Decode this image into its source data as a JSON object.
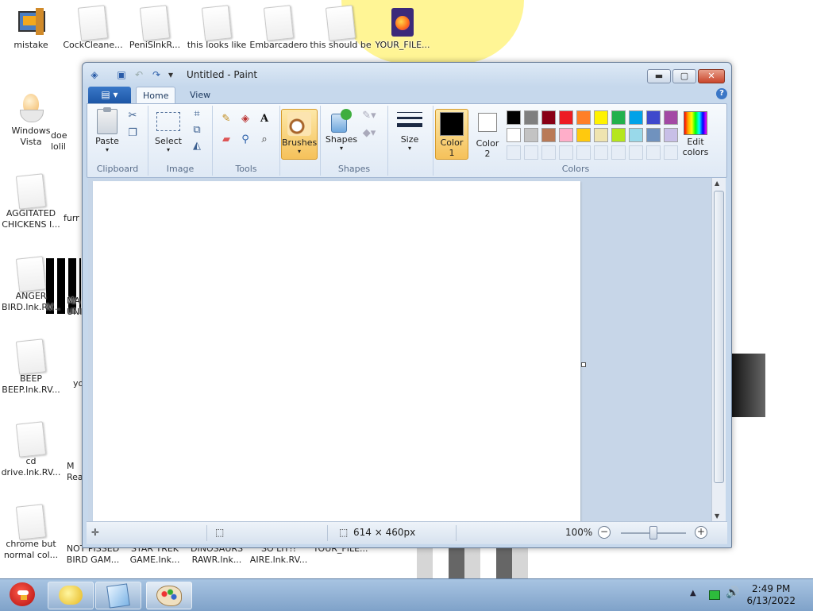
{
  "desktop": {
    "icons": [
      {
        "label": "mistake"
      },
      {
        "label": "CockCleane..."
      },
      {
        "label": "PeniSlnkR..."
      },
      {
        "label": "this looks like"
      },
      {
        "label": "Embarcadero"
      },
      {
        "label": "this should be"
      },
      {
        "label": "YOUR_FILE..."
      },
      {
        "label": "Windows\nVista"
      },
      {
        "label": "AGGITATED\nCHICKENS I..."
      },
      {
        "label": "ANGER\nBIRD.lnk.RV..."
      },
      {
        "label": "BEEP\nBEEP.lnk.RV..."
      },
      {
        "label": "cd\ndrive.lnk.RV..."
      },
      {
        "label": "chrome but\nnormal col..."
      },
      {
        "label": "NOT PISSED\nBIRD GAM..."
      },
      {
        "label": "STAR TREK\nGAME.lnk..."
      },
      {
        "label": "DINOSAURS\nRAWR.lnk..."
      },
      {
        "label": "SO LIT!!\nAIRE.lnk.RV..."
      },
      {
        "label": "YOUR_FILE..."
      }
    ],
    "partial_labels": [
      "doe\nlolil",
      "furr",
      "MA\nUNI",
      "yo",
      "M\nRea"
    ]
  },
  "paint": {
    "title": "Untitled - Paint",
    "tabs": {
      "home": "Home",
      "view": "View"
    },
    "groups": {
      "clipboard": "Clipboard",
      "image": "Image",
      "tools": "Tools",
      "shapes": "Shapes",
      "colors": "Colors"
    },
    "buttons": {
      "paste": "Paste",
      "select": "Select",
      "brushes": "Brushes",
      "shapes": "Shapes",
      "size": "Size",
      "color1_line1": "Color",
      "color1_line2": "1",
      "color2_line1": "Color",
      "color2_line2": "2",
      "edit_colors_line1": "Edit",
      "edit_colors_line2": "colors"
    },
    "palette_colors": [
      "#000000",
      "#7f7f7f",
      "#880015",
      "#ed1c24",
      "#ff7f27",
      "#fff200",
      "#22b14c",
      "#00a2e8",
      "#3f48cc",
      "#a349a4",
      "#ffffff",
      "#c3c3c3",
      "#b97a57",
      "#ffaec9",
      "#ffc90e",
      "#efe4b0",
      "#b5e61d",
      "#99d9ea",
      "#7092be",
      "#c8bfe7"
    ],
    "color1_value": "#000000",
    "color2_value": "#ffffff",
    "status": {
      "canvas_size": "614 × 460px",
      "zoom": "100%"
    }
  },
  "taskbar": {
    "time": "2:49 PM",
    "date": "6/13/2022"
  }
}
